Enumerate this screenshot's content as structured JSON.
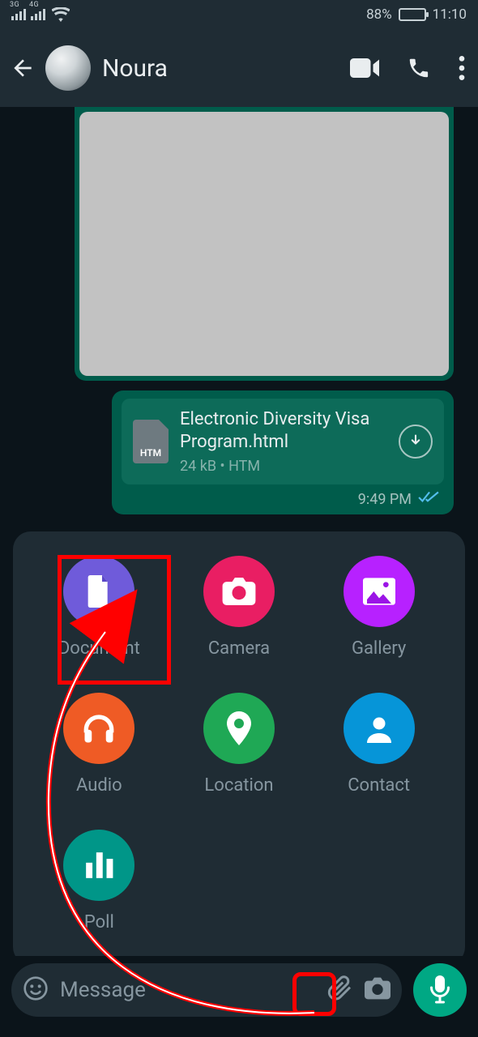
{
  "status": {
    "net1": "3G",
    "net2": "4G",
    "battery_pct": "88%",
    "time": "11:10"
  },
  "header": {
    "chat_name": "Noura"
  },
  "messages": {
    "doc": {
      "name": "Electronic Diversity Visa Program.html",
      "size": "24 kB",
      "sep": "•",
      "ext_badge": "HTM",
      "ext": "HTM",
      "time": "9:49 PM"
    }
  },
  "attach": {
    "document": "Document",
    "camera": "Camera",
    "gallery": "Gallery",
    "audio": "Audio",
    "location": "Location",
    "contact": "Contact",
    "poll": "Poll"
  },
  "input": {
    "placeholder": "Message"
  }
}
